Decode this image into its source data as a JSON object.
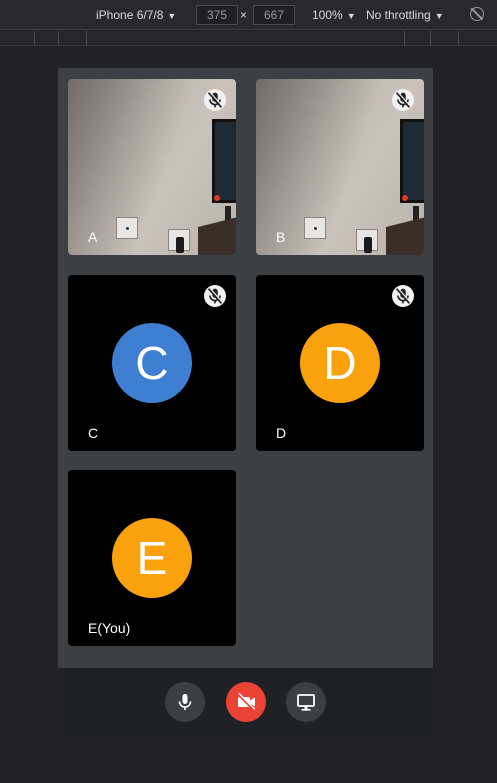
{
  "devtools": {
    "device": "iPhone 6/7/8",
    "width": "375",
    "height": "667",
    "zoom": "100%",
    "throttling": "No throttling"
  },
  "tiles": [
    {
      "label": "A",
      "kind": "video",
      "muted": true
    },
    {
      "label": "B",
      "kind": "video",
      "muted": true
    },
    {
      "label": "C",
      "kind": "avatar",
      "initial": "C",
      "color": "#3e7fd1",
      "muted": true
    },
    {
      "label": "D",
      "kind": "avatar",
      "initial": "D",
      "color": "#f9a20e",
      "muted": true
    },
    {
      "label": "E(You)",
      "kind": "avatar",
      "initial": "E",
      "color": "#f9a20e",
      "muted": false
    }
  ],
  "controls": {
    "mic": "microphone-icon",
    "camera": "camera-off-icon",
    "camera_color": "#ea4335",
    "screen": "screen-share-icon"
  }
}
